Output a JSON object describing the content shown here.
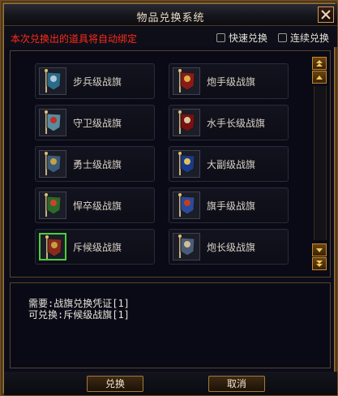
{
  "window": {
    "title": "物品兑换系统"
  },
  "notice": "本次兑换出的道具将自动绑定",
  "options": {
    "quick_exchange": "快速兑换",
    "continuous_exchange": "连续兑换"
  },
  "items": [
    {
      "label": "步兵级战旗",
      "icon": "infantry-banner-icon"
    },
    {
      "label": "炮手级战旗",
      "icon": "gunner-banner-icon"
    },
    {
      "label": "守卫级战旗",
      "icon": "guard-banner-icon"
    },
    {
      "label": "水手长级战旗",
      "icon": "boatswain-banner-icon"
    },
    {
      "label": "勇士级战旗",
      "icon": "warrior-banner-icon"
    },
    {
      "label": "大副级战旗",
      "icon": "first-mate-banner-icon"
    },
    {
      "label": "悍卒级战旗",
      "icon": "veteran-banner-icon"
    },
    {
      "label": "旗手级战旗",
      "icon": "flag-bearer-banner-icon"
    },
    {
      "label": "斥候级战旗",
      "icon": "scout-banner-icon",
      "selected": true
    },
    {
      "label": "炮长级战旗",
      "icon": "chief-gunner-banner-icon"
    }
  ],
  "requirement": {
    "need": "需要:战旗兑换凭证[1]",
    "can_exchange": "可兑换:斥候级战旗[1]"
  },
  "buttons": {
    "exchange": "兑换",
    "cancel": "取消"
  },
  "colors": {
    "notice": "#ff2a1a",
    "selected_border": "#4ccf3c",
    "frame": "#8a6a36"
  }
}
